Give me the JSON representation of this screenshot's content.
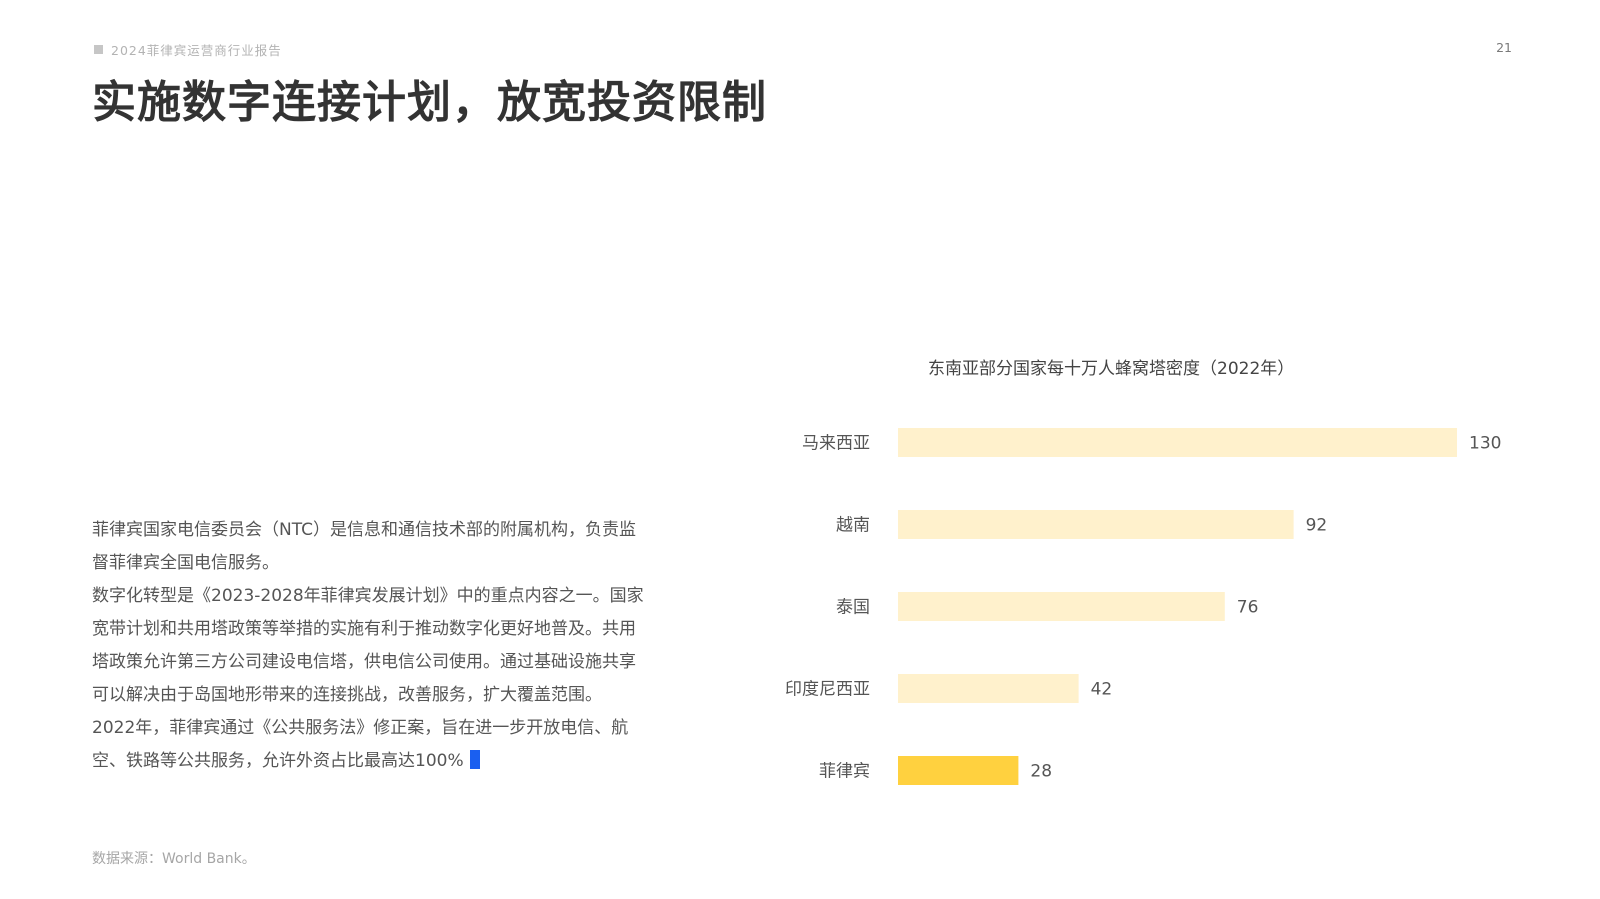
{
  "header": {
    "report_name": "2024菲律宾运营商行业报告",
    "page_number": "21"
  },
  "title": "实施数字连接计划，放宽投资限制",
  "body": {
    "paragraphs": [
      "菲律宾国家电信委员会（NTC）是信息和通信技术部的附属机构，负责监督菲律宾全国电信服务。",
      "数字化转型是《2023-2028年菲律宾发展计划》中的重点内容之一。国家宽带计划和共用塔政策等举措的实施有利于推动数字化更好地普及。共用塔政策允许第三方公司建设电信塔，供电信公司使用。通过基础设施共享可以解决由于岛国地形带来的连接挑战，改善服务，扩大覆盖范围。",
      "2022年，菲律宾通过《公共服务法》修正案，旨在进一步开放电信、航空、铁路等公共服务，允许外资占比最高达100%"
    ]
  },
  "source": "数据来源：World Bank。",
  "colors": {
    "bar_default": "#fff1cc",
    "bar_highlight": "#ffd13f",
    "cursor": "#1a5ff0"
  },
  "chart_data": {
    "type": "bar",
    "orientation": "horizontal",
    "title": "东南亚部分国家每十万人蜂窝塔密度（2022年）",
    "categories": [
      "马来西亚",
      "越南",
      "泰国",
      "印度尼西亚",
      "菲律宾"
    ],
    "values": [
      130,
      92,
      76,
      42,
      28
    ],
    "highlight": "菲律宾",
    "xlim": [
      0,
      130
    ],
    "grid": false,
    "data_labels": true
  }
}
